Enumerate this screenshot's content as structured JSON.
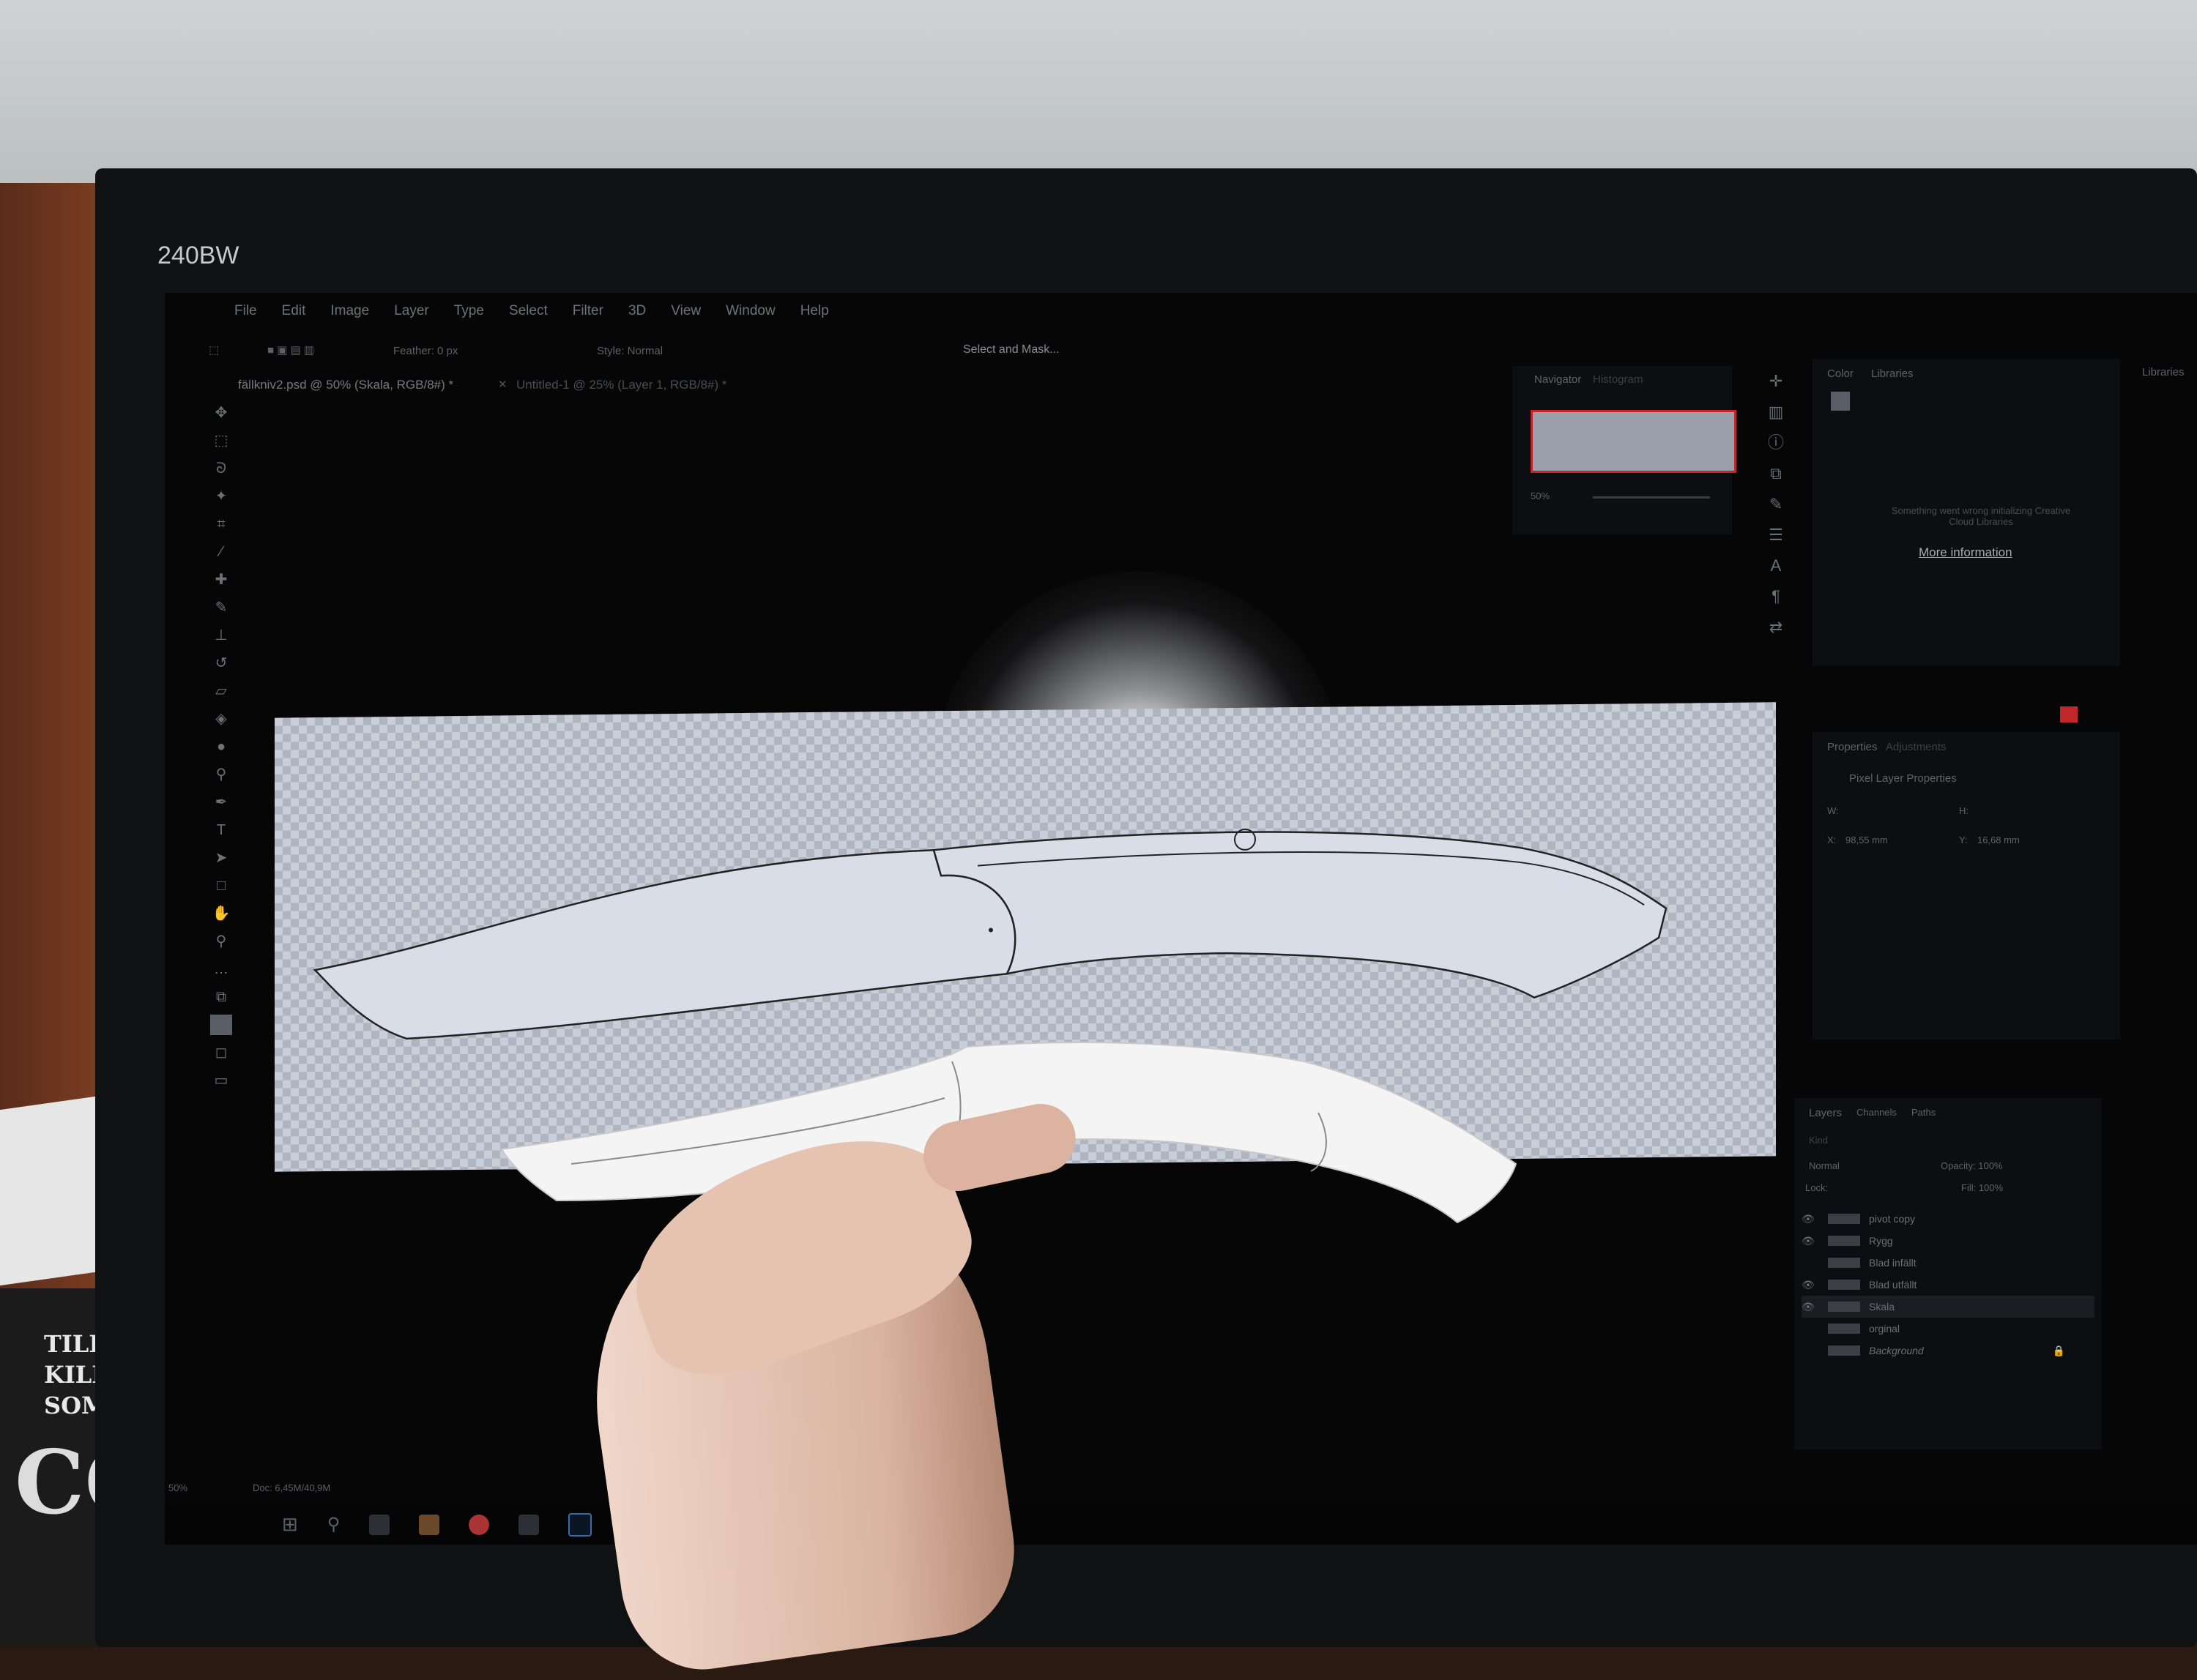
{
  "monitor": {
    "brand": "240BW"
  },
  "book": {
    "lines": [
      "TILL EN",
      "KILLE",
      "SOM ÄR"
    ],
    "big": "COOL"
  },
  "photoshop": {
    "menu": [
      "File",
      "Edit",
      "Image",
      "Layer",
      "Type",
      "Select",
      "Filter",
      "3D",
      "View",
      "Window",
      "Help"
    ],
    "options": {
      "feather": "Feather: 0 px",
      "style": "Style: Normal",
      "select_mask": "Select and Mask..."
    },
    "tabs": {
      "active": "fällkniv2.psd @ 50% (Skala, RGB/8#) *",
      "inactive": "Untitled-1 @ 25% (Layer 1, RGB/8#) *"
    },
    "navigator": {
      "tab": "Navigator",
      "tab2": "Histogram",
      "zoom": "50%"
    },
    "color_panel": {
      "tabs": [
        "Color",
        "Libraries"
      ]
    },
    "libraries": {
      "label": "Libraries",
      "error": "Something went wrong initializing Creative Cloud Libraries",
      "link": "More information"
    },
    "properties": {
      "tabs": [
        "Properties",
        "Adjustments"
      ],
      "title": "Pixel Layer Properties",
      "w_label": "W:",
      "h_label": "H:",
      "x": "98,55 mm",
      "y": "16,68 mm",
      "x_label": "X:",
      "y_label": "Y:"
    },
    "layers_panel": {
      "tabs": [
        "Layers",
        "Channels",
        "Paths"
      ],
      "kind": "Kind",
      "blend": "Normal",
      "opacity": "Opacity: 100%",
      "lock": "Lock:",
      "fill": "Fill: 100%",
      "layers": [
        {
          "name": "pivot copy",
          "visible": true
        },
        {
          "name": "Rygg",
          "visible": true
        },
        {
          "name": "Blad infällt",
          "visible": false
        },
        {
          "name": "Blad utfällt",
          "visible": true
        },
        {
          "name": "Skala",
          "visible": true
        },
        {
          "name": "orginal",
          "visible": false
        },
        {
          "name": "Background",
          "visible": false
        }
      ]
    },
    "status": {
      "zoom": "50%",
      "doc": "Doc: 6,45M/40,9M"
    }
  },
  "colors": {
    "canvas_check": "#aeb4c0",
    "accent_red": "#c0262a"
  }
}
